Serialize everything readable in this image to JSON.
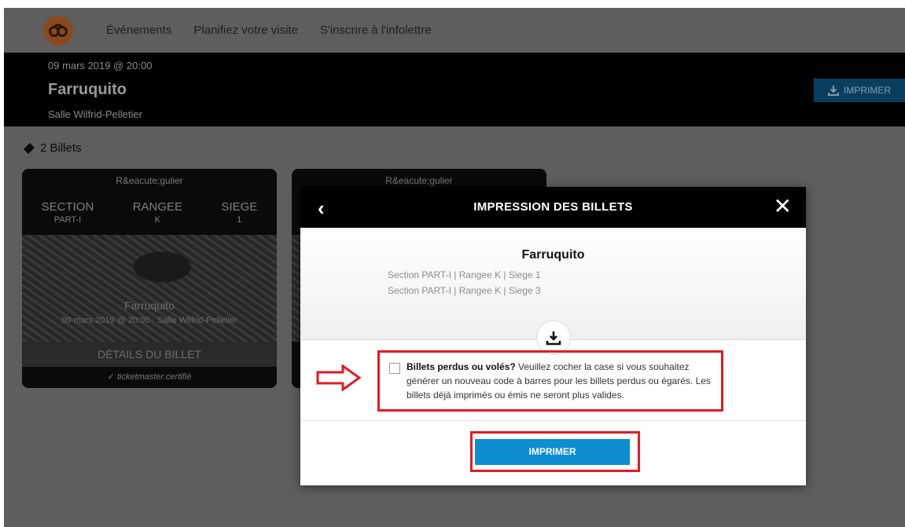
{
  "nav": {
    "logo_icon": "ticketmaster-logo-icon",
    "links": [
      "Événements",
      "Planifiez votre visite",
      "S'inscrire à l'infolettre"
    ]
  },
  "event": {
    "date": "09 mars 2019 @ 20:00",
    "title": "Farruquito",
    "venue": "Salle Wilfrid-Pelletier",
    "print_label": "IMPRIMER"
  },
  "tickets": {
    "count_label": "2 Billets",
    "items": [
      {
        "type": "R&eacute;gulier",
        "section_label": "SECTION",
        "section": "PART-I",
        "row_label": "RANGEE",
        "row": "K",
        "seat_label": "SIEGE",
        "seat": "1",
        "photo_title": "Farruquito",
        "photo_sub": "09 mars 2019 @ 20:00 · Salle Wilfrid-Pelletier",
        "details_label": "DÉTAILS DU BILLET",
        "cert_label": "ticketmaster.certifié"
      },
      {
        "type": "R&eacute;gulier"
      }
    ]
  },
  "modal": {
    "title": "IMPRESSION DES BILLETS",
    "event_name": "Farruquito",
    "lines": [
      "Section PART-I | Rangee K | Siege 1",
      "Section PART-I | Rangee K | Siege 3"
    ],
    "lost_bold": "Billets perdus ou volés?",
    "lost_text": " Veuillez cocher la case si vous souhaitez générer un nouveau code à barres pour les billets perdus ou égarés. Les billets déjà imprimés ou émis ne seront plus valides.",
    "print_label": "IMPRIMER"
  },
  "colors": {
    "accent": "#0e8dd0",
    "highlight": "#e21b23",
    "header": "#000000"
  }
}
